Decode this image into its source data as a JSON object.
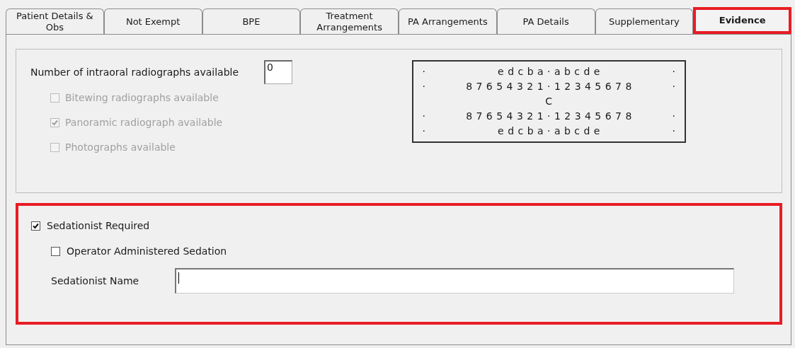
{
  "tabs": [
    {
      "label": "Patient Details & Obs",
      "selected": false,
      "highlighted": false
    },
    {
      "label": "Not Exempt",
      "selected": false,
      "highlighted": false
    },
    {
      "label": "BPE",
      "selected": false,
      "highlighted": false
    },
    {
      "label": "Treatment Arrangements",
      "selected": false,
      "highlighted": false
    },
    {
      "label": "PA Arrangements",
      "selected": false,
      "highlighted": false
    },
    {
      "label": "PA Details",
      "selected": false,
      "highlighted": false
    },
    {
      "label": "Supplementary",
      "selected": false,
      "highlighted": false
    },
    {
      "label": "Evidence",
      "selected": true,
      "highlighted": true
    }
  ],
  "radiographs": {
    "label": "Number of intraoral radiographs available",
    "value": "0",
    "options": [
      {
        "label": "Bitewing radiographs available",
        "checked": false,
        "disabled": true
      },
      {
        "label": "Panoramic radiograph available",
        "checked": true,
        "disabled": true
      },
      {
        "label": "Photographs available",
        "checked": false,
        "disabled": true
      }
    ]
  },
  "tooth_chart": [
    {
      "left": "·",
      "center": "e d c b a · a b c d e",
      "right": "·"
    },
    {
      "left": "·",
      "center": "8 7 6 5 4 3 2 1 · 1 2 3 4 5 6 7 8",
      "right": "·"
    },
    {
      "center": "C"
    },
    {
      "left": "·",
      "center": "8 7 6 5 4 3 2 1 · 1 2 3 4 5 6 7 8",
      "right": "·"
    },
    {
      "left": "·",
      "center": "e d c b a · a b c d e",
      "right": "·"
    }
  ],
  "sedation": {
    "highlighted": true,
    "sedationist_required": {
      "label": "Sedationist Required",
      "checked": true
    },
    "operator_administered": {
      "label": "Operator Administered Sedation",
      "checked": false
    },
    "name_field": {
      "label": "Sedationist Name"
    }
  }
}
